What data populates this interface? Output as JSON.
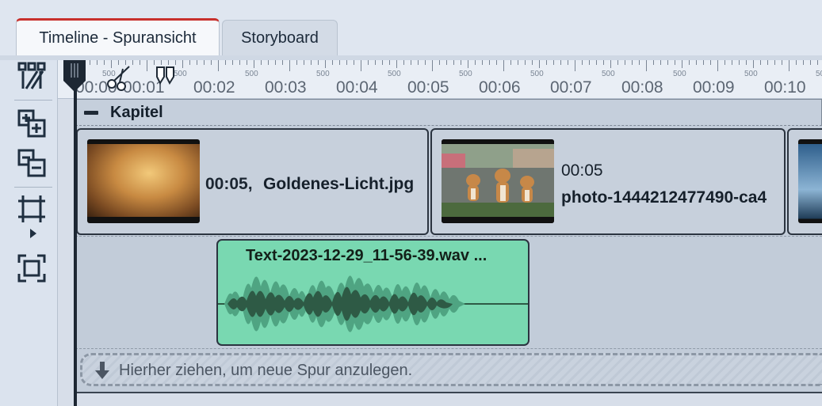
{
  "tabs": [
    {
      "label": "Timeline - Spuransicht",
      "active": true
    },
    {
      "label": "Storyboard",
      "active": false
    }
  ],
  "toolbar": {
    "tools": [
      "chapter-markers-icon",
      "add-track-icon",
      "remove-track-icon",
      "crop-frame-icon",
      "fit-frame-icon"
    ]
  },
  "ruler": {
    "labels": [
      "00:00",
      "00:01",
      "00:02",
      "00:03",
      "00:04",
      "00:05",
      "00:06",
      "00:07",
      "00:08",
      "00:09",
      "00:10"
    ],
    "sublabel": "500"
  },
  "chapter": {
    "label": "Kapitel"
  },
  "clips": [
    {
      "duration": "00:05,",
      "name": "Goldenes-Licht.jpg"
    },
    {
      "duration": "00:05",
      "name": "photo-1444212477490-ca4"
    }
  ],
  "audio": {
    "name": "Text-2023-12-29_11-56-39.wav ..."
  },
  "drop_zone": {
    "text": "Hierher ziehen, um neue Spur anzulegen."
  },
  "colors": {
    "accent_tab": "#c8302c",
    "audio_clip": "#79d8b1",
    "waveform_dark": "#2e5a45",
    "waveform_light": "#4fa482"
  }
}
